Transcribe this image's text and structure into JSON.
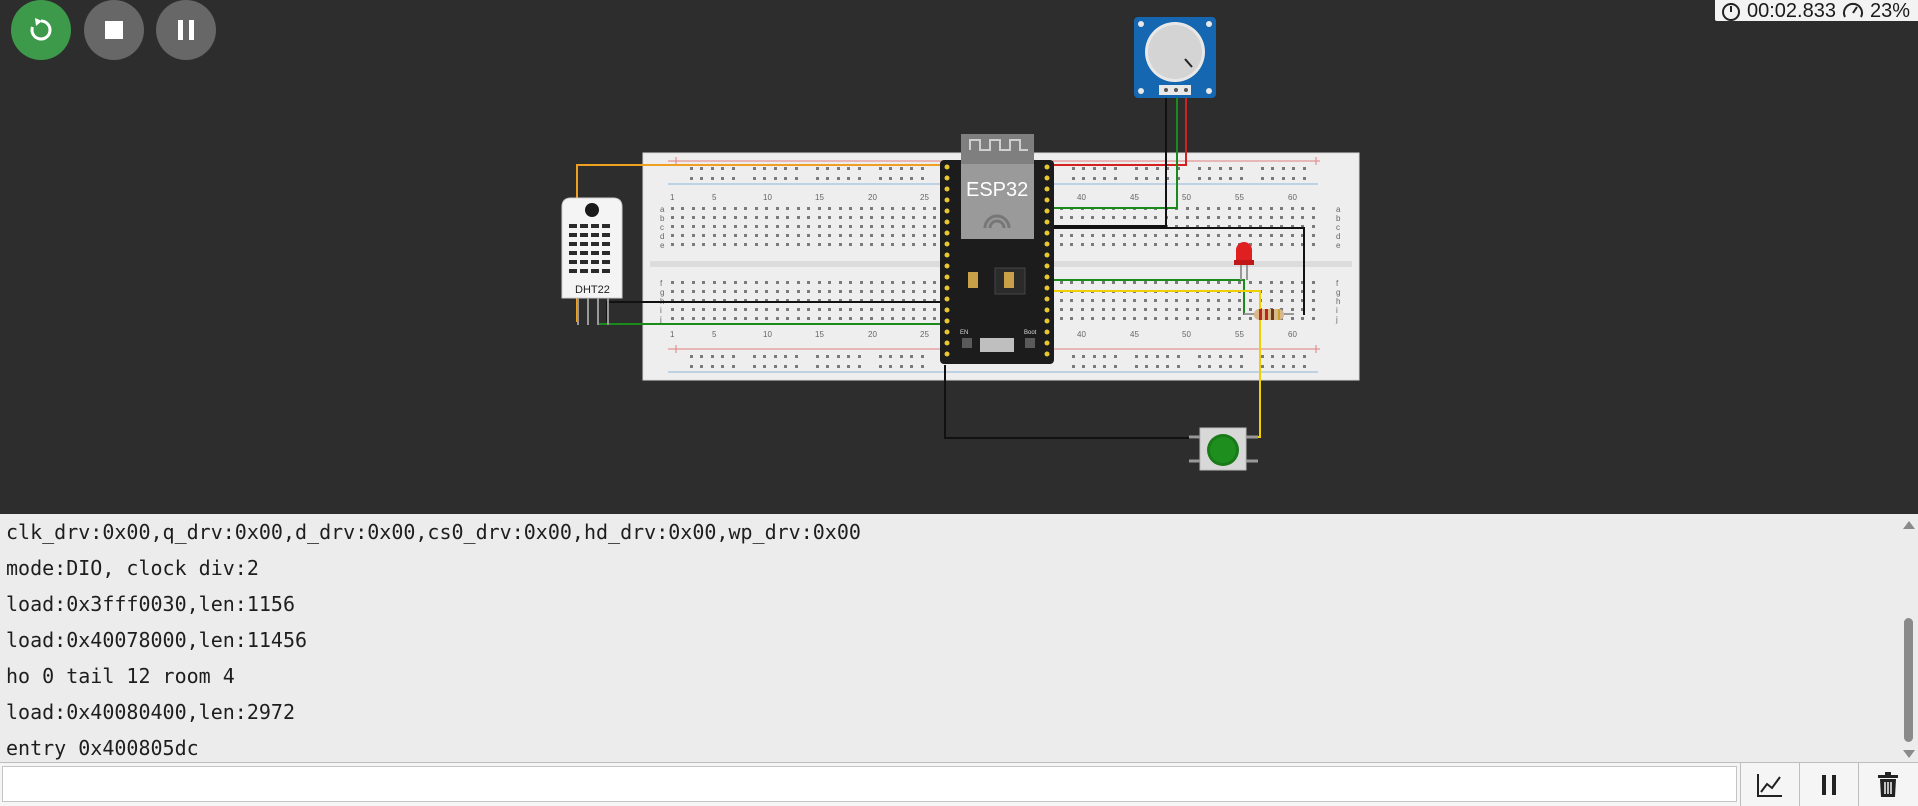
{
  "controls": {
    "restart": {
      "icon": "restart-icon",
      "color": "#3d9a4a"
    },
    "stop": {
      "icon": "stop-icon"
    },
    "pause": {
      "icon": "pause-icon"
    }
  },
  "status": {
    "elapsed_time": "00:02.833",
    "performance": "23%"
  },
  "circuit": {
    "esp32_label": "ESP32",
    "sensor_label": "DHT22",
    "breadboard_numbers": [
      "1",
      "5",
      "10",
      "15",
      "20",
      "25",
      "40",
      "45",
      "50",
      "55",
      "60"
    ],
    "breadboard_rows_top": [
      "a",
      "b",
      "c",
      "d",
      "e"
    ],
    "breadboard_rows_bottom": [
      "f",
      "g",
      "h",
      "i",
      "j"
    ],
    "en_label": "EN",
    "boot_label": "Boot"
  },
  "serial_monitor": {
    "lines": [
      "clk_drv:0x00,q_drv:0x00,d_drv:0x00,cs0_drv:0x00,hd_drv:0x00,wp_drv:0x00",
      "mode:DIO, clock div:2",
      "load:0x3fff0030,len:1156",
      "load:0x40078000,len:11456",
      "ho 0 tail 12 room 4",
      "load:0x40080400,len:2972",
      "entry 0x400805dc"
    ],
    "input_value": "",
    "input_placeholder": ""
  },
  "toolbar": {
    "plotter_icon": "chart-icon",
    "pause_icon": "pause-icon",
    "clear_icon": "trash-icon"
  }
}
